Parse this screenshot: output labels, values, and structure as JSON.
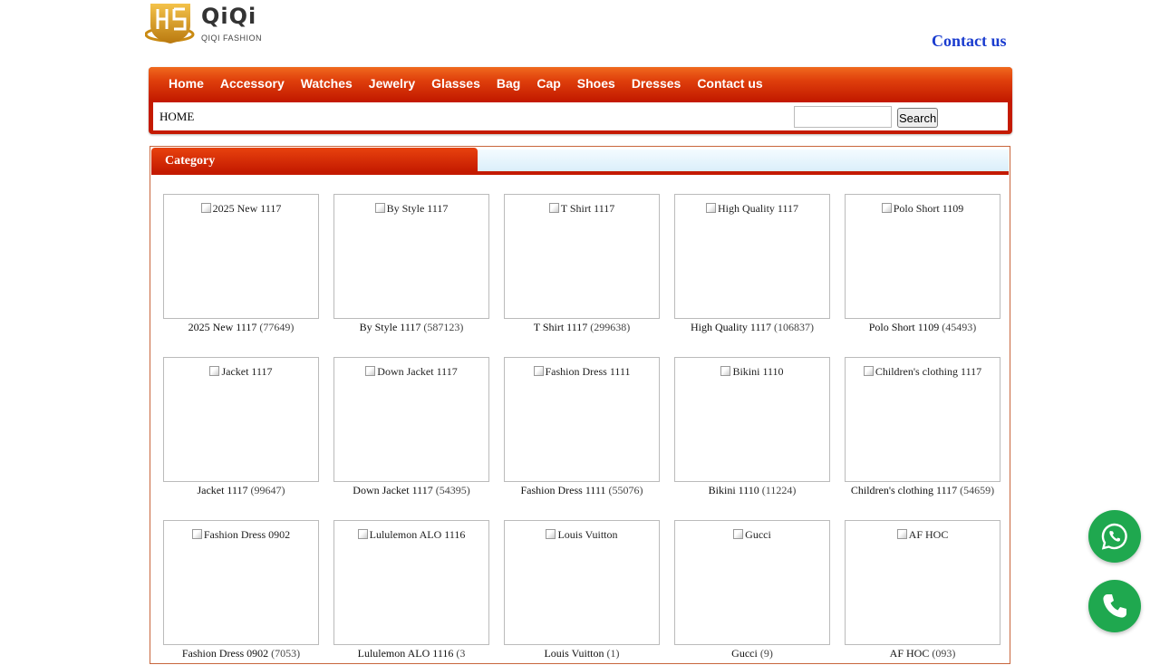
{
  "brand": {
    "name": "QiQi",
    "tagline": "QIQI FASHION"
  },
  "header": {
    "contact_label": "Contact us"
  },
  "nav": {
    "items": [
      "Home",
      "Accessory",
      "Watches",
      "Jewelry",
      "Glasses",
      "Bag",
      "Cap",
      "Shoes",
      "Dresses",
      "Contact us"
    ]
  },
  "breadcrumb": "HOME",
  "search": {
    "button_label": "Search",
    "value": ""
  },
  "category": {
    "title": "Category",
    "items": [
      {
        "name": "2025 New 1117",
        "count": "(77649)"
      },
      {
        "name": "By Style 1117",
        "count": "(587123)"
      },
      {
        "name": "T Shirt 1117",
        "count": "(299638)"
      },
      {
        "name": "High Quality 1117",
        "count": "(106837)"
      },
      {
        "name": "Polo Short 1109",
        "count": "(45493)"
      },
      {
        "name": "Jacket 1117",
        "count": "(99647)"
      },
      {
        "name": "Down Jacket 1117",
        "count": "(54395)"
      },
      {
        "name": "Fashion Dress 1111",
        "count": "(55076)"
      },
      {
        "name": "Bikini 1110",
        "count": "(11224)"
      },
      {
        "name": "Children's clothing 1117",
        "count": "(54659)"
      },
      {
        "name": "Fashion Dress 0902",
        "count": "(7053)"
      },
      {
        "name": "Lululemon ALO 1116",
        "count": "(3"
      },
      {
        "name": "Louis Vuitton",
        "count": "(1)"
      },
      {
        "name": "Gucci",
        "count": "(9)"
      },
      {
        "name": "AF HOC",
        "count": "(093)"
      }
    ]
  },
  "floating": {
    "whatsapp_icon": "whatsapp-icon",
    "phone_icon": "phone-icon",
    "color": "#1fa84f"
  }
}
